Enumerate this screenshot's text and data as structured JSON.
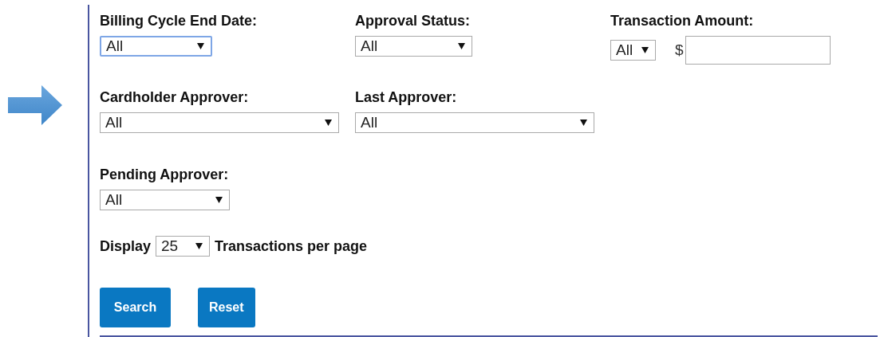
{
  "rows": [
    [
      {
        "kind": "select",
        "label": "Billing Cycle End Date:",
        "value": "All",
        "focused": true
      },
      {
        "kind": "select",
        "label": "Approval Status:",
        "value": "All",
        "focused": false
      },
      {
        "kind": "amount",
        "label": "Transaction Amount:",
        "value": "All",
        "currency": "$",
        "focused": false
      }
    ],
    [
      {
        "kind": "select",
        "label": "Cardholder Approver:",
        "value": "All",
        "focused": false
      },
      {
        "kind": "select",
        "label": "Last Approver:",
        "value": "All",
        "focused": false
      }
    ],
    [
      {
        "kind": "select",
        "label": "Pending Approver:",
        "value": "All",
        "focused": false
      }
    ]
  ],
  "display": {
    "prefix": "Display",
    "value": "25",
    "suffix": "Transactions per page"
  },
  "buttons": [
    "Search",
    "Reset"
  ]
}
